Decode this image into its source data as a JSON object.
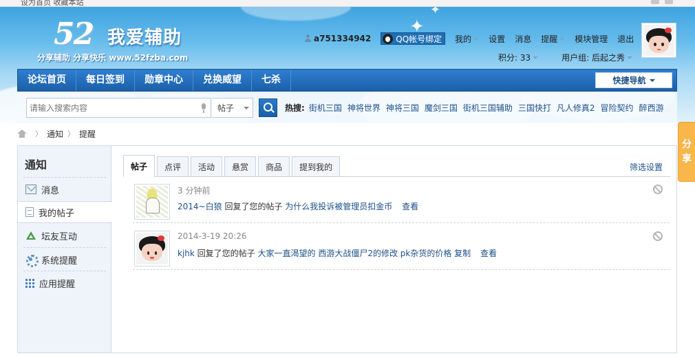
{
  "topbar": {
    "text": "设为首页 收藏本站"
  },
  "logo": {
    "number": "52",
    "name": "我爱辅助",
    "slogan": "分享辅助 分享快乐 www.52fzba.com"
  },
  "user": {
    "username": "a751334942",
    "qq_bind": "QQ帐号绑定",
    "links": [
      "我的",
      "设置",
      "消息",
      "提醒",
      "模块管理",
      "退出"
    ],
    "points": "积分: 33",
    "group": "用户组: 后起之秀"
  },
  "navbar": {
    "items": [
      "论坛首页",
      "每日签到",
      "勋章中心",
      "兑换威望",
      "七杀"
    ],
    "quick_nav": "快捷导航"
  },
  "search": {
    "placeholder": "请输入搜索内容",
    "type": "帖子",
    "hot_label": "热搜:",
    "hot_terms": [
      "街机三国",
      "神将世界",
      "神将三国",
      "魔剑三国",
      "街机三国辅助",
      "三国快打",
      "凡人修真2",
      "冒险契约",
      "醉西游"
    ]
  },
  "breadcrumb": [
    "通知",
    "提醒"
  ],
  "sidebar": {
    "title": "通知",
    "items": [
      "消息",
      "我的帖子",
      "坛友互动",
      "系统提醒",
      "应用提醒"
    ],
    "active": "我的帖子"
  },
  "tabs": {
    "items": [
      "帖子",
      "点评",
      "活动",
      "悬赏",
      "商品",
      "提到我的"
    ],
    "active": "帖子",
    "filter": "筛选设置"
  },
  "notifications": [
    {
      "time": "3 分钟前",
      "user": "2014~白狼",
      "action": "回复了您的帖子",
      "title": "为什么我投诉被管理员扣金币",
      "view": "查看"
    },
    {
      "time": "2014-3-19 20:26",
      "user": "kjhk",
      "action": "回复了您的帖子",
      "title": "大家一直渴望的 西游大战僵尸2的修改 pk杂货的价格 复制",
      "view": "查看"
    }
  ],
  "share": {
    "label": "分享"
  }
}
